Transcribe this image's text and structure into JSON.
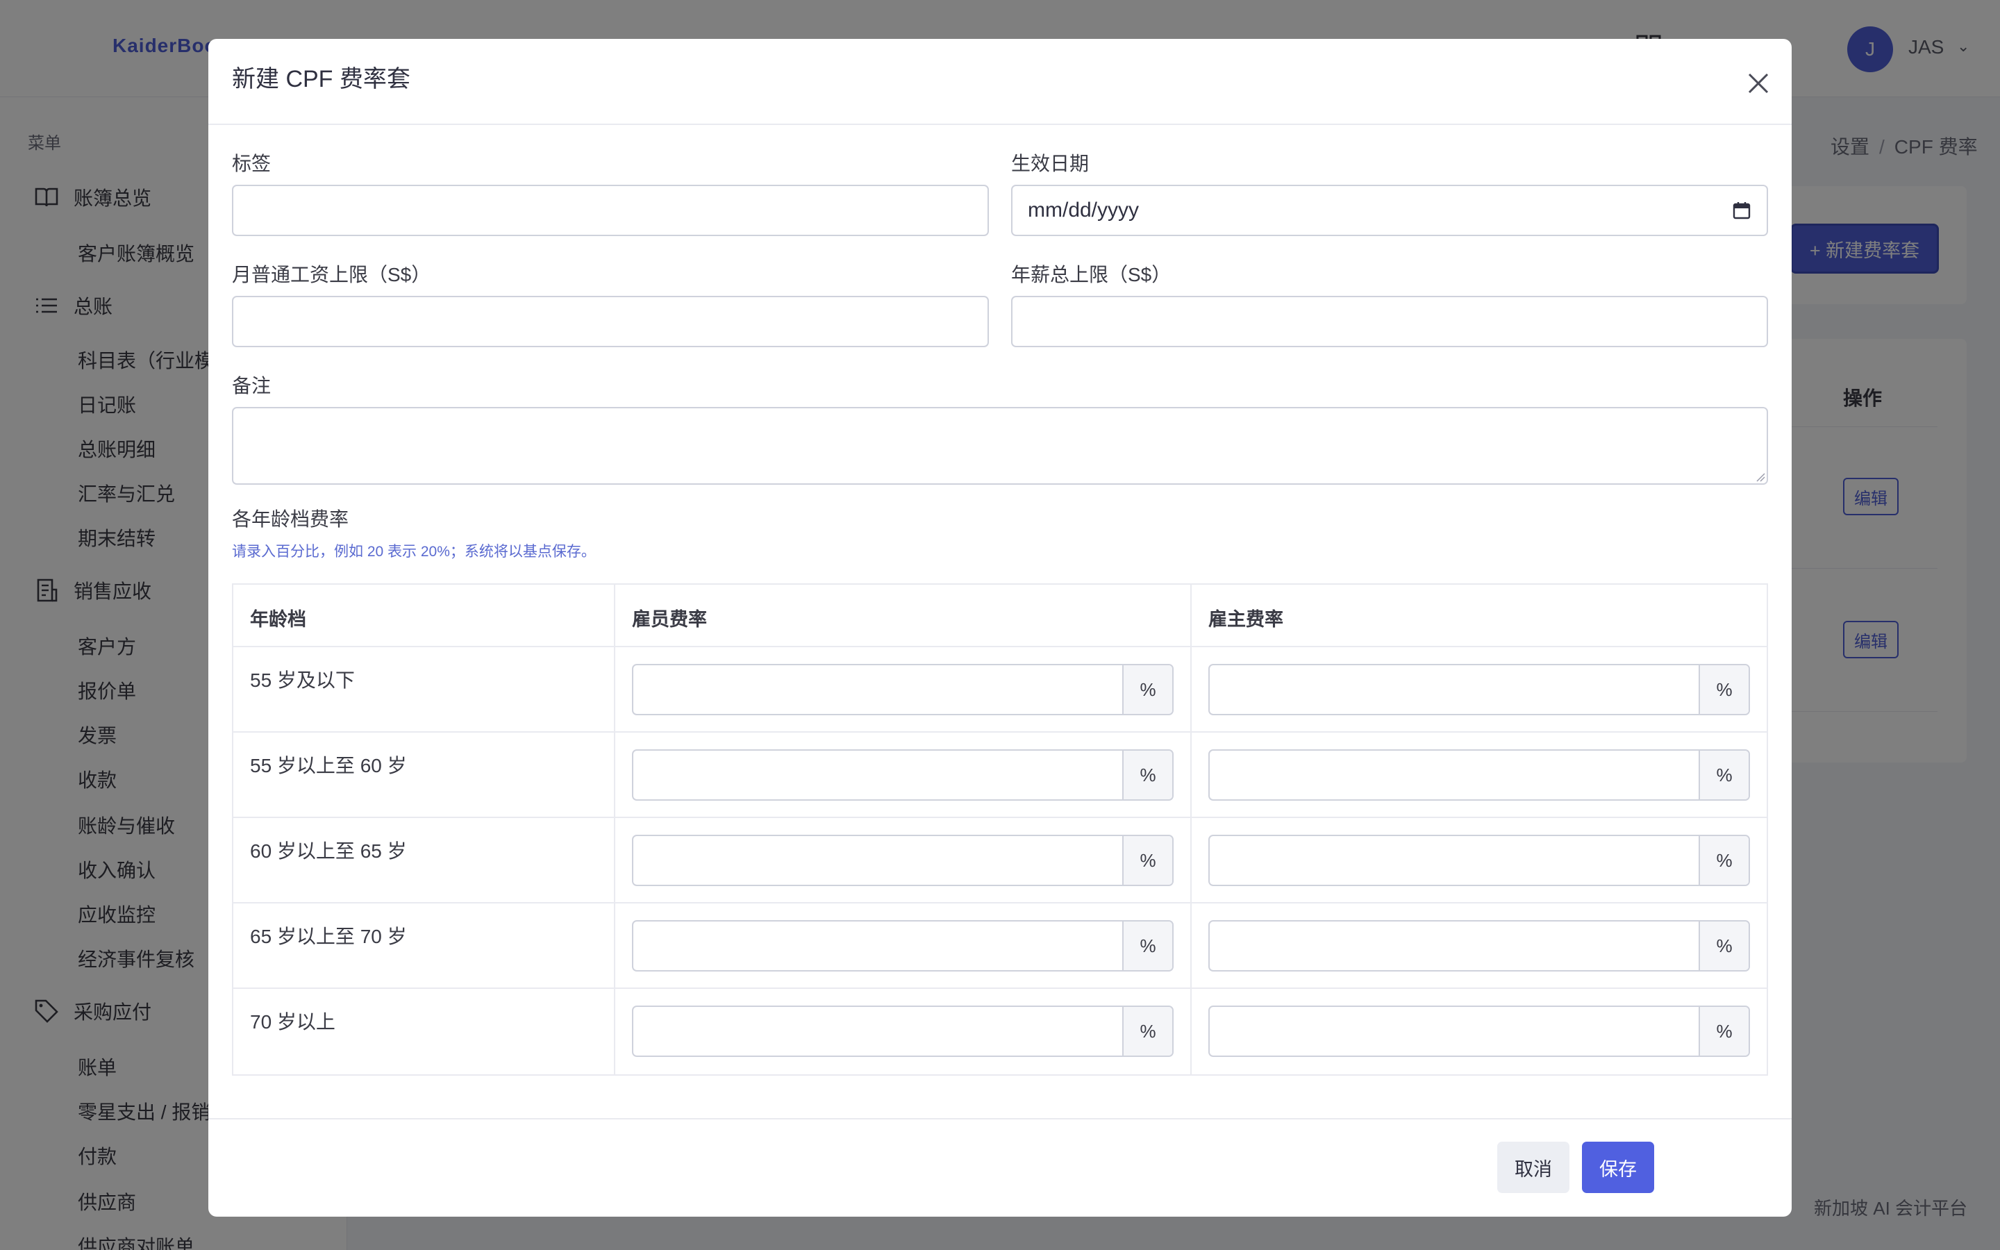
{
  "app": {
    "brand": "KaiderBoo",
    "user_initial": "J",
    "user_name": "JAS"
  },
  "sidebar": {
    "menu_heading": "菜单",
    "groups": [
      {
        "label": "账簿总览",
        "icon": "book-icon",
        "items": [
          "客户账簿概览"
        ]
      },
      {
        "label": "总账",
        "icon": "list-icon",
        "items": [
          "科目表（行业模",
          "日记账",
          "总账明细",
          "汇率与汇兑",
          "期末结转"
        ]
      },
      {
        "label": "销售应收",
        "icon": "receipt-icon",
        "items": [
          "客户方",
          "报价单",
          "发票",
          "收款",
          "账龄与催收",
          "收入确认",
          "应收监控",
          "经济事件复核"
        ]
      },
      {
        "label": "采购应付",
        "icon": "tag-icon",
        "items": [
          "账单",
          "零星支出 / 报销",
          "付款",
          "供应商",
          "供应商对账单"
        ]
      }
    ]
  },
  "page": {
    "breadcrumb": [
      "设置",
      "CPF 费率"
    ],
    "new_button": "+ 新建费率套",
    "action_header": "操作",
    "edit_label": "编辑",
    "footer_text": "新加坡 AI 会计平台"
  },
  "modal": {
    "title": "新建 CPF 费率套",
    "fields": {
      "label_label": "标签",
      "label_value": "",
      "effective_date_label": "生效日期",
      "effective_date_value": "mm/dd/yyyy",
      "monthly_wage_cap_label": "月普通工资上限（S$）",
      "monthly_wage_cap_value": "",
      "annual_wage_cap_label": "年薪总上限（S$）",
      "annual_wage_cap_value": "",
      "notes_label": "备注",
      "notes_value": ""
    },
    "rates_section": {
      "title": "各年龄档费率",
      "hint": "请录入百分比，例如 20 表示 20%；系统将以基点保存。",
      "columns": [
        "年龄档",
        "雇员费率",
        "雇主费率"
      ],
      "rows": [
        {
          "age_band": "55 岁及以下",
          "employee_rate": "",
          "employer_rate": ""
        },
        {
          "age_band": "55 岁以上至 60 岁",
          "employee_rate": "",
          "employer_rate": ""
        },
        {
          "age_band": "60 岁以上至 65 岁",
          "employee_rate": "",
          "employer_rate": ""
        },
        {
          "age_band": "65 岁以上至 70 岁",
          "employee_rate": "",
          "employer_rate": ""
        },
        {
          "age_band": "70 岁以上",
          "employee_rate": "",
          "employer_rate": ""
        }
      ],
      "percent_suffix": "%"
    },
    "buttons": {
      "cancel": "取消",
      "save": "保存"
    }
  },
  "colors": {
    "accent": "#4e5fd6",
    "save_button": "#5060e0",
    "overlay": "rgba(0,0,0,0.5)"
  }
}
